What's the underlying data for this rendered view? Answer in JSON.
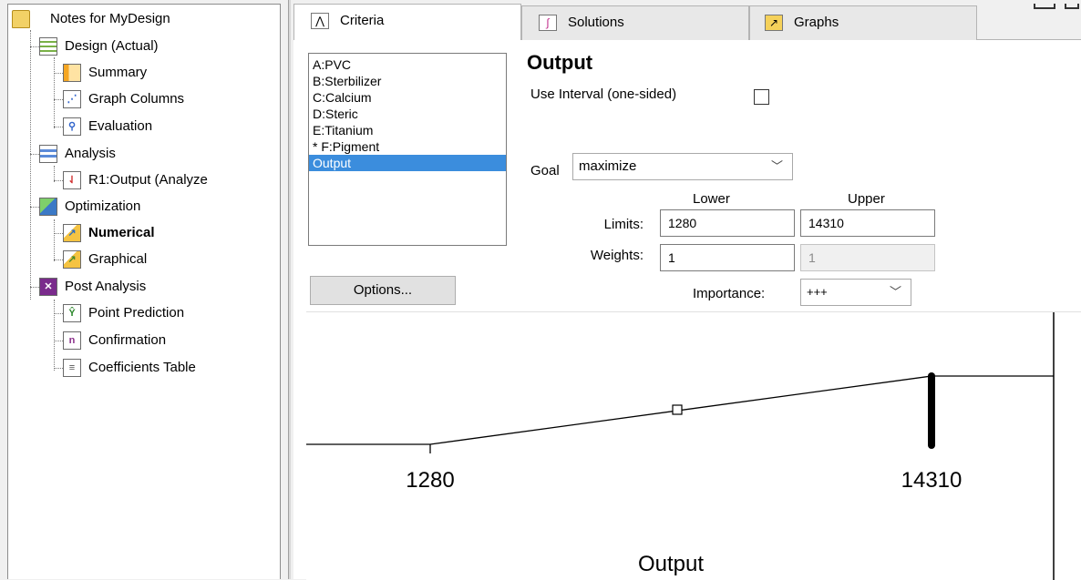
{
  "tree": {
    "root": "Notes for MyDesign",
    "items": [
      {
        "label": "Design (Actual)"
      },
      {
        "label": "Summary"
      },
      {
        "label": "Graph Columns"
      },
      {
        "label": "Evaluation"
      },
      {
        "label": "Analysis"
      },
      {
        "label": "R1:Output (Analyze"
      },
      {
        "label": "Optimization"
      },
      {
        "label": "Numerical"
      },
      {
        "label": "Graphical"
      },
      {
        "label": "Post Analysis"
      },
      {
        "label": "Point Prediction"
      },
      {
        "label": "Confirmation"
      },
      {
        "label": "Coefficients Table"
      }
    ]
  },
  "tabs": [
    {
      "label": "Criteria",
      "icon": "criteria-icon"
    },
    {
      "label": "Solutions",
      "icon": "solutions-icon"
    },
    {
      "label": "Graphs",
      "icon": "graphs-icon"
    }
  ],
  "factors": [
    "A:PVC",
    "B:Sterbilizer",
    "C:Calcium",
    "D:Steric",
    "E:Titanium",
    "* F:Pigment",
    "Output"
  ],
  "selected_factor": "Output",
  "criteria": {
    "title": "Output",
    "interval_label": "Use Interval (one-sided)",
    "goal_label": "Goal",
    "goal_value": "maximize",
    "lower_label": "Lower",
    "upper_label": "Upper",
    "limits_label": "Limits:",
    "weights_label": "Weights:",
    "lower_limit": "1280",
    "upper_limit": "14310",
    "lower_weight": "1",
    "upper_weight": "1",
    "importance_label": "Importance:",
    "importance_value": "+++",
    "options_button": "Options..."
  },
  "graph": {
    "lower_tick": "1280",
    "upper_tick": "14310",
    "xlabel": "Output"
  },
  "colors": {
    "selection": "#3b8ddd"
  }
}
